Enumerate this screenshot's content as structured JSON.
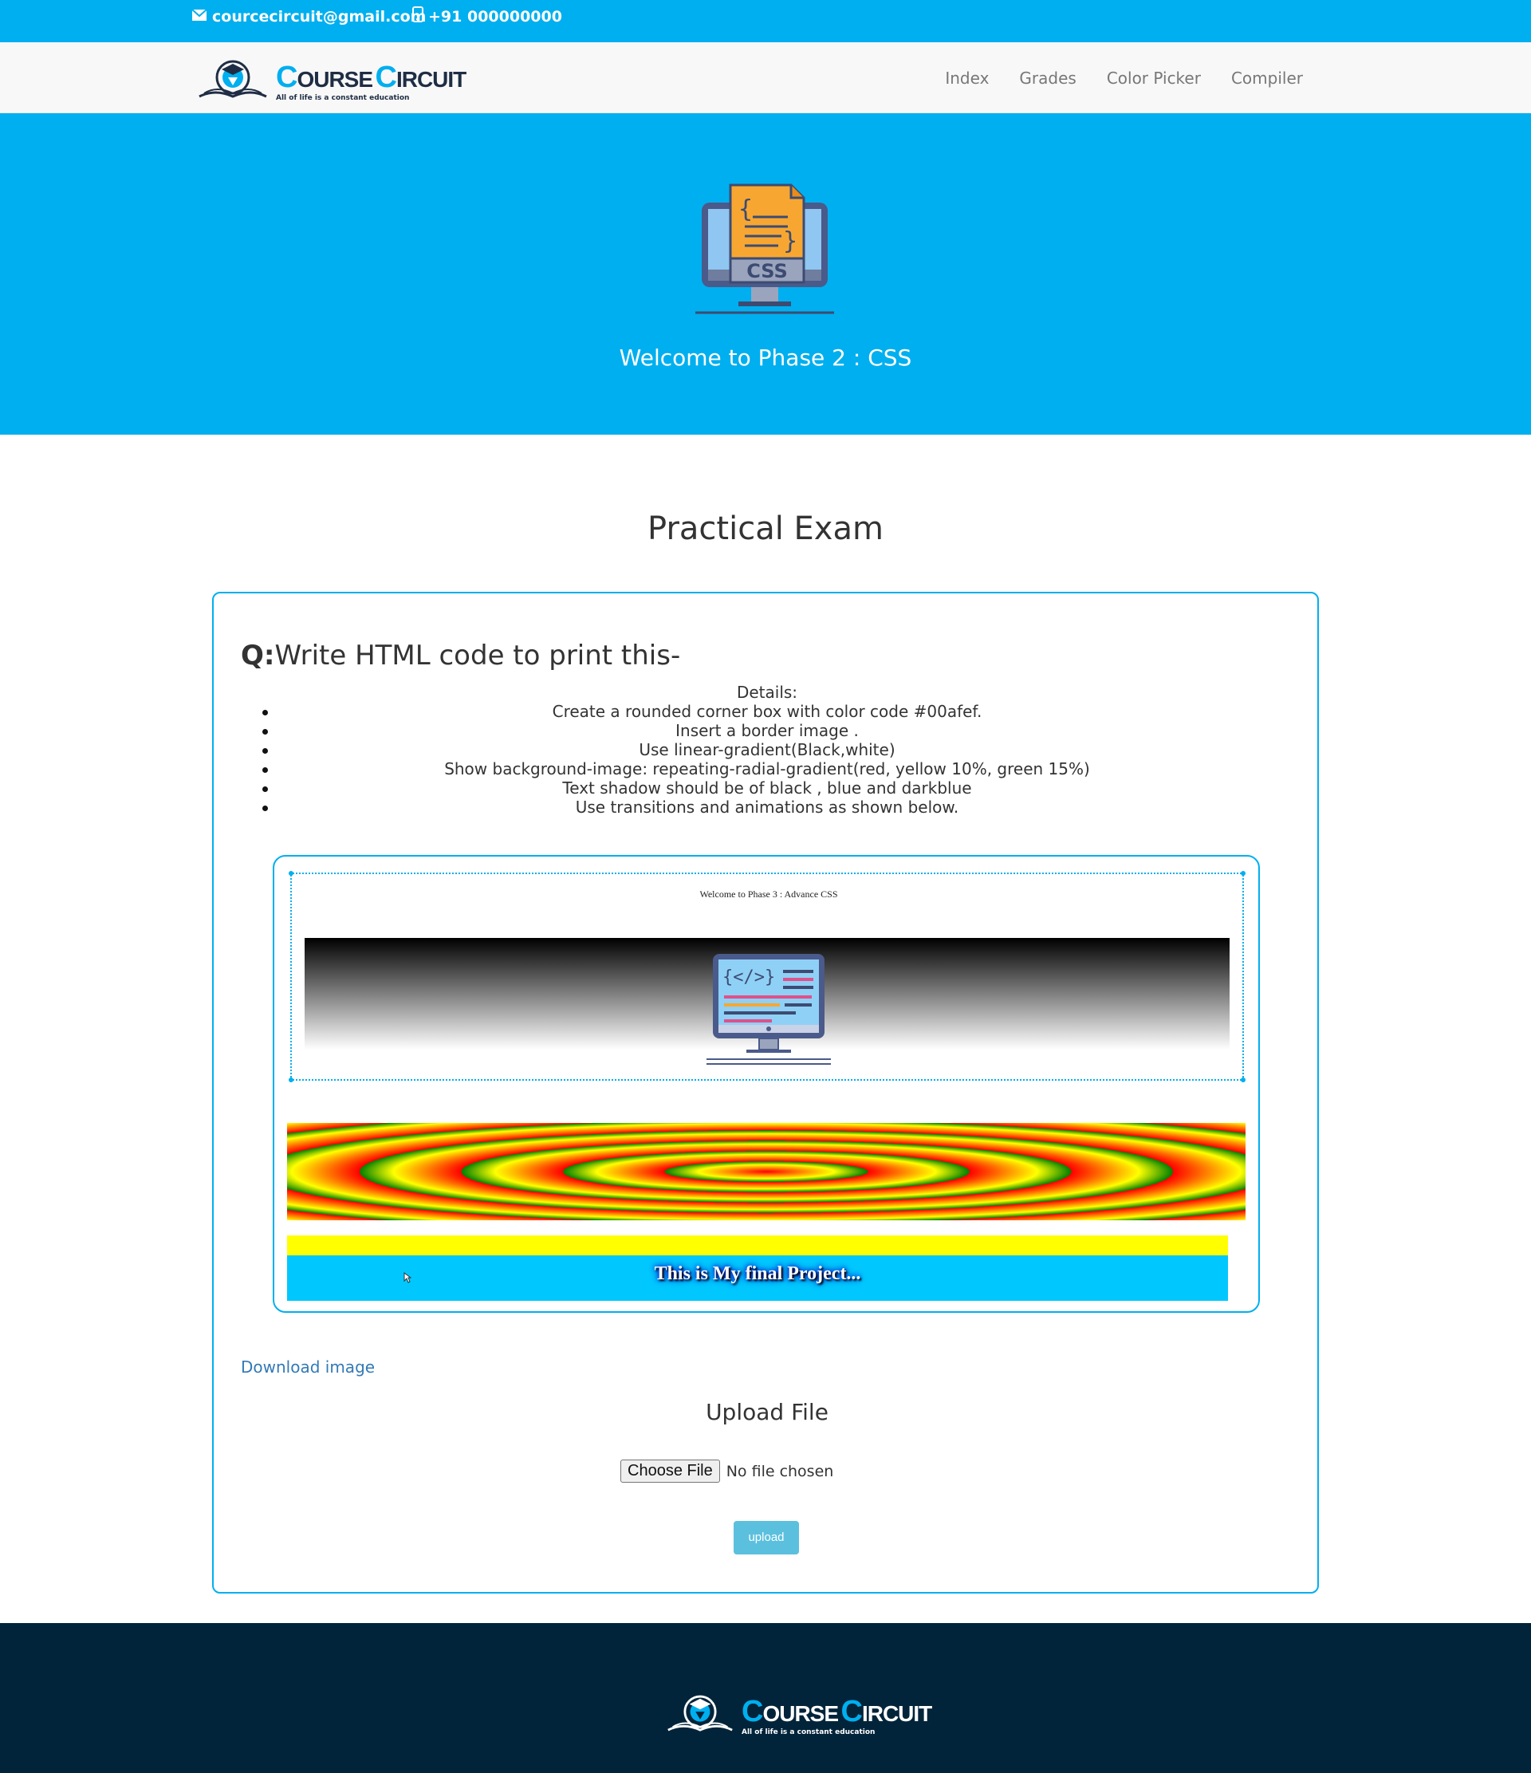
{
  "topbar": {
    "email": "courcecircuit@gmail.com",
    "phone": "+91 000000000",
    "email_icon": "envelope-icon",
    "phone_icon": "mobile-phone-icon"
  },
  "brand": {
    "first_cap": "C",
    "first_rest": "OURSE",
    "second_cap": "C",
    "second_rest": "IRCUIT",
    "tagline": "All of life is a constant education"
  },
  "nav": {
    "items": [
      {
        "label": "Index"
      },
      {
        "label": "Grades"
      },
      {
        "label": "Color Picker"
      },
      {
        "label": "Compiler"
      }
    ]
  },
  "hero": {
    "icon_label": "CSS",
    "title": "Welcome to Phase 2 : CSS"
  },
  "main": {
    "heading": "Practical Exam",
    "question_prefix": "Q:",
    "question_text": "Write HTML code to print this-",
    "details_title": "Details:",
    "details": [
      "Create a rounded corner box with color code #00afef.",
      "Insert a border image .",
      "Use linear-gradient(Black,white)",
      "Show background-image: repeating-radial-gradient(red, yellow 10%, green 15%)",
      "Text shadow should be of black , blue and darkblue",
      "Use transitions and animations as shown below."
    ],
    "preview": {
      "title": "Welcome to Phase 3 : Advance CSS",
      "final_text": "This is My final Project..."
    },
    "download_link": "Download image",
    "upload_title": "Upload File",
    "choose_file": "Choose File",
    "no_file": "No file chosen",
    "upload_button": "upload"
  },
  "colors": {
    "accent": "#00afef",
    "footer_bg": "#02243a",
    "upload_btn": "#5bc0de",
    "link": "#337ab7"
  }
}
